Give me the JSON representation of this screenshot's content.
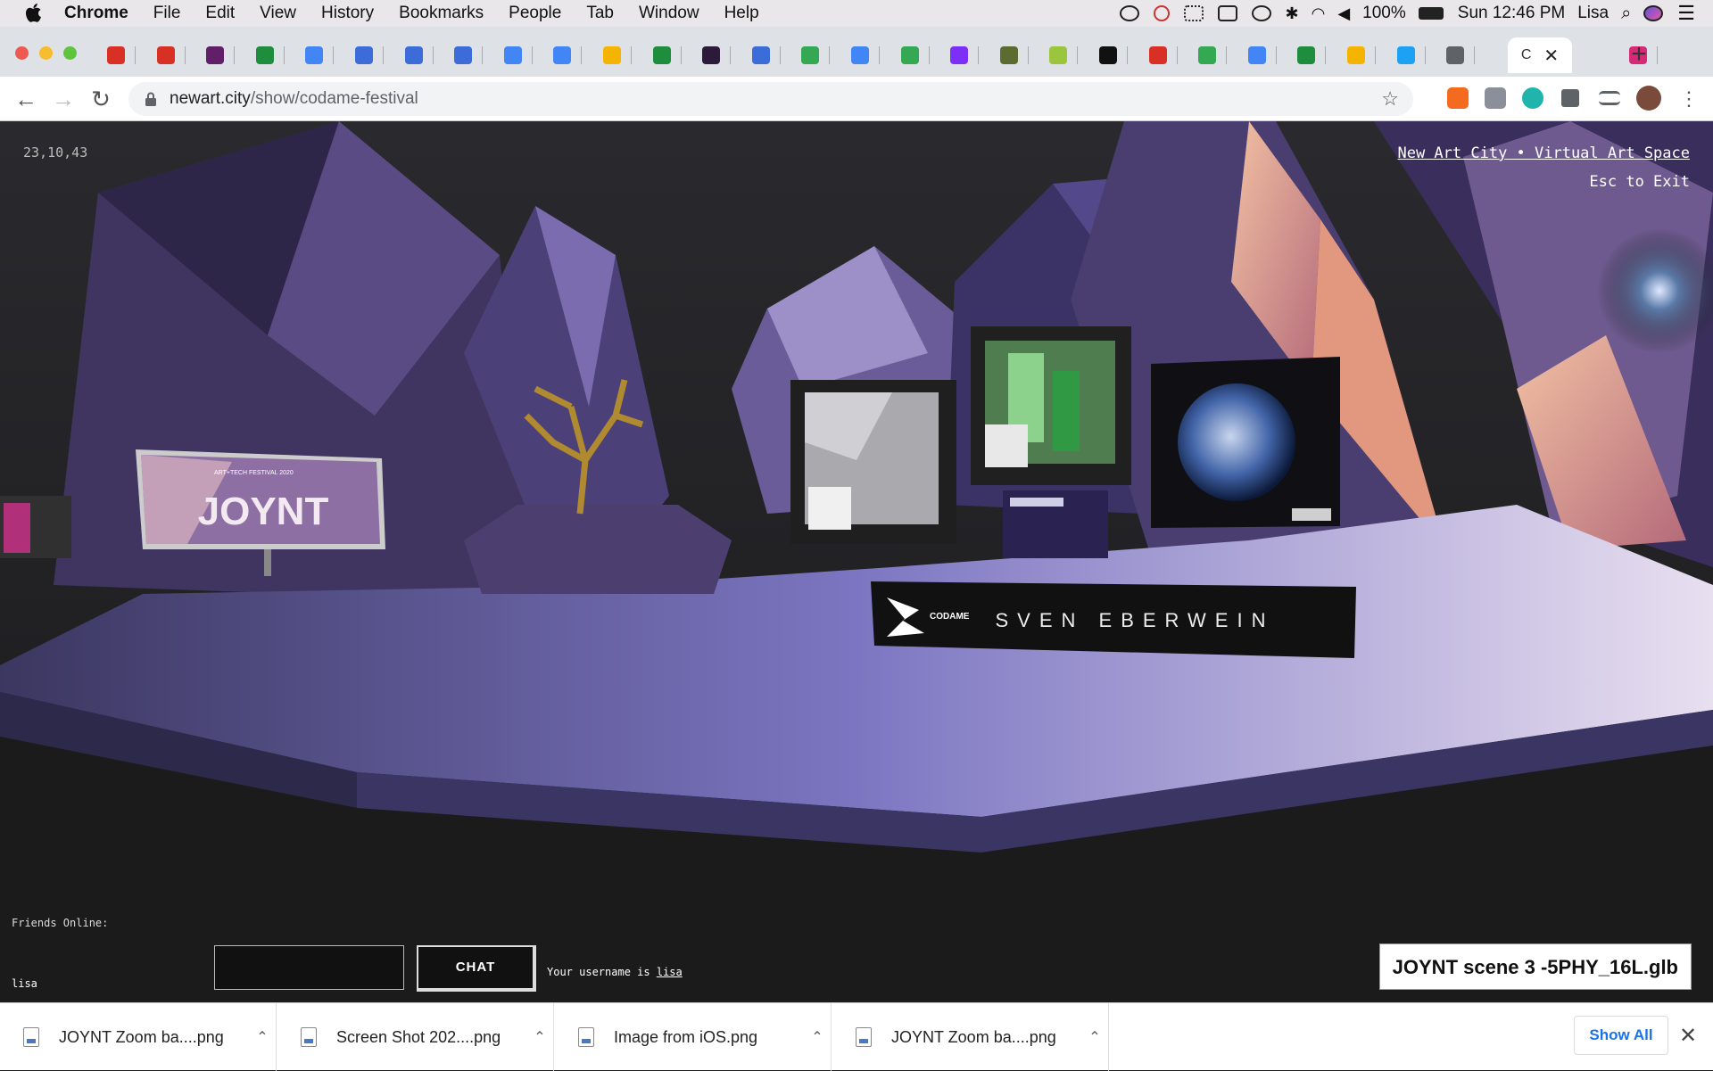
{
  "menubar": {
    "app": "Chrome",
    "menus": [
      "File",
      "Edit",
      "View",
      "History",
      "Bookmarks",
      "People",
      "Tab",
      "Window",
      "Help"
    ],
    "battery": "100%",
    "clock": "Sun 12:46 PM",
    "user": "Lisa"
  },
  "tabs": {
    "active_title": "C",
    "favicons": [
      "gmail",
      "gmail",
      "slack",
      "sheets",
      "docs",
      "canva",
      "canva",
      "canva",
      "docs",
      "docs",
      "slides",
      "sheets",
      "kartra",
      "canva",
      "drive",
      "calendar",
      "drive",
      "email",
      "photo",
      "pear",
      "medium",
      "gmail",
      "drive",
      "docs",
      "sheets",
      "slides",
      "twitter",
      "globe",
      "active",
      "instagram"
    ]
  },
  "toolbar": {
    "url_domain": "newart.city",
    "url_path": "/show/codame-festival"
  },
  "viewport": {
    "coords": "23,10,43",
    "site_link": "New Art City • Virtual Art Space",
    "esc_hint": "Esc to Exit",
    "friends_label": "Friends Online:",
    "friend_name": "lisa",
    "chat_button": "CHAT",
    "chat_placeholder": "",
    "username_prefix": "Your username is ",
    "username": "lisa",
    "file_label": "JOYNT scene 3 -5PHY_16L.glb",
    "joynt_sign": "JOYNT",
    "joynt_small": "ART+TECH FESTIVAL 2020",
    "artist_banner": "SVEN EBERWEIN",
    "codame_logo": "CODAME"
  },
  "downloads": {
    "items": [
      "JOYNT Zoom ba....png",
      "Screen Shot 202....png",
      "Image from iOS.png",
      "JOYNT Zoom ba....png"
    ],
    "show_all": "Show All"
  },
  "colors": {
    "rock_purple": "#4a3f6e",
    "floor": "#6e68b0",
    "accent_peach": "#e9a58a",
    "chrome_blue": "#1a73e8"
  }
}
